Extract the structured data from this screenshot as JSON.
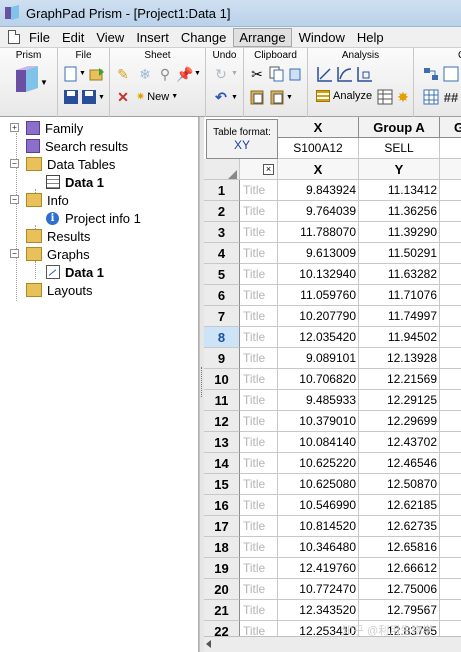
{
  "window": {
    "title": "GraphPad Prism - [Project1:Data 1]"
  },
  "menu": [
    "File",
    "Edit",
    "View",
    "Insert",
    "Change",
    "Arrange",
    "Window",
    "Help"
  ],
  "menu_active": "Arrange",
  "toolbar": {
    "groups": [
      "Prism",
      "File",
      "Sheet",
      "Undo",
      "Clipboard",
      "Analysis"
    ],
    "new_label": "New",
    "analyze_label": "Analyze"
  },
  "navigator": {
    "family": "Family",
    "search_results": "Search results",
    "data_tables": "Data Tables",
    "data_table_1": "Data 1",
    "info": "Info",
    "project_info": "Project info 1",
    "results": "Results",
    "graphs": "Graphs",
    "graph_1": "Data 1",
    "layouts": "Layouts"
  },
  "sheet": {
    "table_format_label": "Table format:",
    "table_format_value": "XY",
    "col_x_header": "X",
    "col_a_header": "Group A",
    "col_b_header_partial": "G",
    "col_x_title": "S100A12",
    "col_a_title": "SELL",
    "sub_x": "X",
    "sub_y": "Y",
    "title_placeholder": "Title",
    "x_mark": "×",
    "selected_row": 8,
    "rows": [
      {
        "n": "1",
        "x": "9.843924",
        "y": "11.13412"
      },
      {
        "n": "2",
        "x": "9.764039",
        "y": "11.36256"
      },
      {
        "n": "3",
        "x": "11.788070",
        "y": "11.39290"
      },
      {
        "n": "4",
        "x": "9.613009",
        "y": "11.50291"
      },
      {
        "n": "5",
        "x": "10.132940",
        "y": "11.63282"
      },
      {
        "n": "6",
        "x": "11.059760",
        "y": "11.71076"
      },
      {
        "n": "7",
        "x": "10.207790",
        "y": "11.74997"
      },
      {
        "n": "8",
        "x": "12.035420",
        "y": "11.94502"
      },
      {
        "n": "9",
        "x": "9.089101",
        "y": "12.13928"
      },
      {
        "n": "10",
        "x": "10.706820",
        "y": "12.21569"
      },
      {
        "n": "11",
        "x": "9.485933",
        "y": "12.29125"
      },
      {
        "n": "12",
        "x": "10.379010",
        "y": "12.29699"
      },
      {
        "n": "13",
        "x": "10.084140",
        "y": "12.43702"
      },
      {
        "n": "14",
        "x": "10.625220",
        "y": "12.46546"
      },
      {
        "n": "15",
        "x": "10.625080",
        "y": "12.50870"
      },
      {
        "n": "16",
        "x": "10.546990",
        "y": "12.62185"
      },
      {
        "n": "17",
        "x": "10.814520",
        "y": "12.62735"
      },
      {
        "n": "18",
        "x": "10.346480",
        "y": "12.65816"
      },
      {
        "n": "19",
        "x": "12.419760",
        "y": "12.66612"
      },
      {
        "n": "20",
        "x": "10.772470",
        "y": "12.75006"
      },
      {
        "n": "21",
        "x": "12.343520",
        "y": "12.79567"
      },
      {
        "n": "22",
        "x": "12.253410",
        "y": "12.83765"
      }
    ]
  },
  "watermark": "知乎 @利用生物学"
}
